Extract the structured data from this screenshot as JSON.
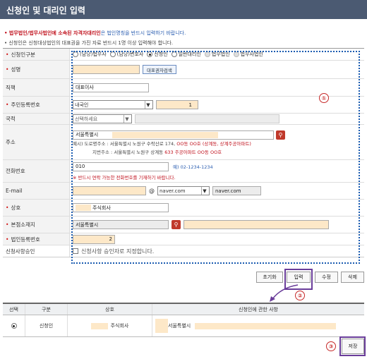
{
  "header": {
    "title": "신청인 및 대리인 입력"
  },
  "notice": {
    "line1_red": "• 법무법인/법무사법인에 소속된 자격자대리인",
    "line1_blue": "은 법인명칭을 반드시 입력하기 바랍니다.",
    "line2": "• 신청인은 신청대상법인의 대표권을 가진 자료 반드시 1명 이상 입력해야 합니다."
  },
  "form": {
    "applicant_type": {
      "label": "신청인구분",
      "options": [
        "(담당)법무사",
        "(담당)변호사",
        "신청인",
        "일반대리인",
        "법무법인",
        "법무사법인"
      ],
      "selected": "신청인"
    },
    "name": {
      "label": "성명",
      "button": "대표권자검색"
    },
    "position": {
      "label": "직책",
      "value": "대표이사"
    },
    "resident_no": {
      "label": "주민등록번호",
      "nationality": "내국인",
      "value": "1"
    },
    "country": {
      "label": "국적",
      "placeholder": "선택하세요"
    },
    "address": {
      "label": "주소",
      "value": "서울특별시",
      "example1_prefix": "예시) 도로명주소 : 서울특별시 노원구 수락산로 174,",
      "example1_red": "OO동 OO호 (상계동, 상계주공아파트)",
      "example2_prefix": "지번주소 : 서울특별시 노원구 상계동",
      "example2_red": "633 주공아파트 OO동 OO호"
    },
    "phone": {
      "label": "전화번호",
      "value": "010",
      "example": "예) 02-1234-1234",
      "warning": "※ 반드시 연락 가능한 전화번호를 기재하기 바랍니다."
    },
    "email": {
      "label": "E-mail",
      "at": "@",
      "domain": "naver.com",
      "domain_field": "naver.com"
    },
    "company_name": {
      "label": "상호",
      "value": "주식회사"
    },
    "hq_location": {
      "label": "본점소재지",
      "value": "서울특별시"
    },
    "corp_reg_no": {
      "label": "법인등록번호",
      "value": "2"
    },
    "approval": {
      "label": "신청사항승인",
      "checkbox": "신청사항 승인자로 지정합니다."
    }
  },
  "actions": {
    "reset": "초기화",
    "input": "입력",
    "edit": "수정",
    "delete": "삭제"
  },
  "table": {
    "headers": [
      "선택",
      "구분",
      "상호",
      "신청인에 관한 사항"
    ],
    "rows": [
      {
        "type": "신청인",
        "company": "주식회사",
        "detail": "서울특별시"
      }
    ]
  },
  "save": "저장",
  "badges": {
    "b1": "①",
    "b2": "②",
    "b3": "③"
  },
  "colors": {
    "header_bg": "#4b5a72",
    "accent_red": "#c0101c",
    "dotted_blue": "#1a5bb0",
    "purple": "#6a3d9a"
  }
}
